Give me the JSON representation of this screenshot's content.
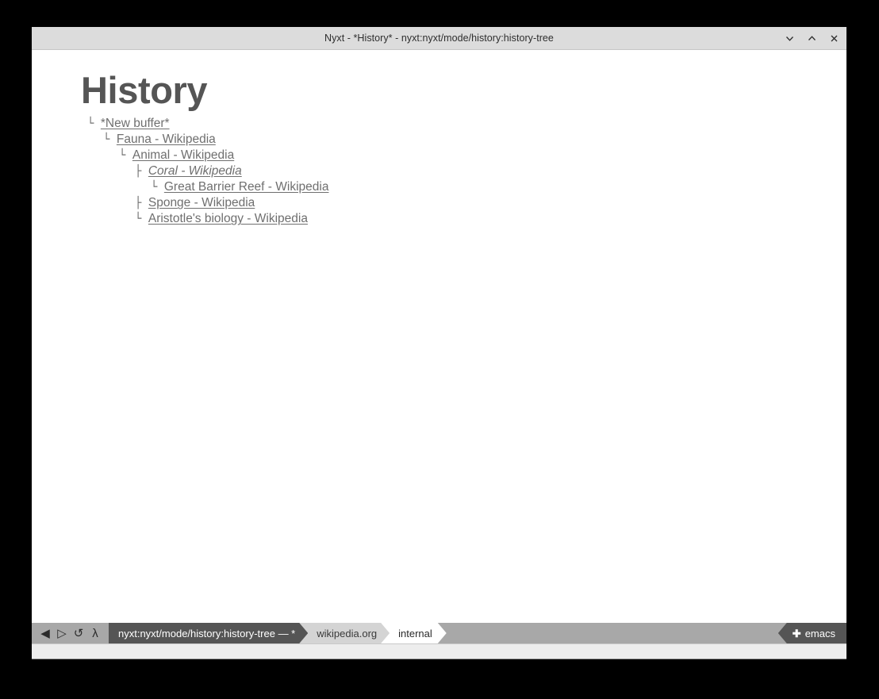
{
  "window": {
    "title": "Nyxt - *History* - nyxt:nyxt/mode/history:history-tree",
    "controls": {
      "minimize": "chevron-down-icon",
      "maximize": "chevron-up-icon",
      "close": "close-icon"
    }
  },
  "page": {
    "heading": "History"
  },
  "history_tree": {
    "rows": [
      {
        "prefix": "└ ",
        "indent": 8,
        "label": "*New buffer*",
        "current": false
      },
      {
        "prefix": "└ ",
        "indent": 28,
        "label": "Fauna - Wikipedia",
        "current": false
      },
      {
        "prefix": "└ ",
        "indent": 48,
        "label": "Animal - Wikipedia",
        "current": false
      },
      {
        "prefix": "├ ",
        "indent": 68,
        "label": "Coral - Wikipedia",
        "current": true
      },
      {
        "prefix": "└ ",
        "indent": 88,
        "label": "Great Barrier Reef - Wikipedia",
        "current": false
      },
      {
        "prefix": "├ ",
        "indent": 68,
        "label": "Sponge - Wikipedia",
        "current": false
      },
      {
        "prefix": "└ ",
        "indent": 68,
        "label": "Aristotle's biology - Wikipedia",
        "current": false
      }
    ]
  },
  "statusbar": {
    "nav": {
      "back": "◀",
      "forward": "▷",
      "reload": "↺",
      "execute": "λ"
    },
    "url": "nyxt:nyxt/mode/history:history-tree — *",
    "domain": "wikipedia.org",
    "mode": "internal",
    "editor": "emacs",
    "editor_icon": "✚"
  },
  "echo": {
    "message": ""
  },
  "colors": {
    "desktop": "#000000",
    "titlebar": "#dcdcdc",
    "page_bg": "#ffffff",
    "heading": "#555555",
    "link": "#6f6f6f",
    "statusbar": "#a8a8a8",
    "seg_url": "#555555",
    "seg_domain": "#d4d4d4",
    "seg_mode": "#ffffff",
    "echo": "#ededed"
  }
}
